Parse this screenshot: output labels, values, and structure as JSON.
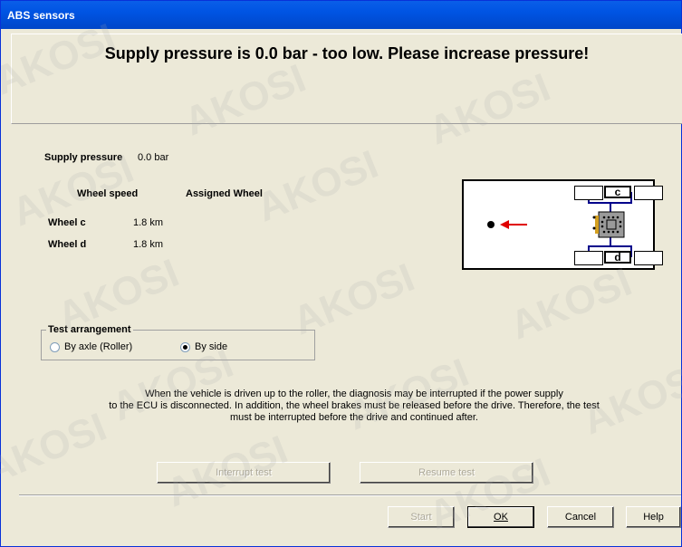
{
  "window": {
    "title": "ABS sensors"
  },
  "header": {
    "message": "Supply pressure is  0.0 bar - too low. Please increase pressure!"
  },
  "supply": {
    "label": "Supply pressure",
    "value": "0.0 bar"
  },
  "table": {
    "col_speed": "Wheel speed",
    "col_assigned": "Assigned Wheel",
    "rows": [
      {
        "wheel": "Wheel c",
        "speed": "1.8 km"
      },
      {
        "wheel": "Wheel d",
        "speed": "1.8 km"
      }
    ]
  },
  "diagram": {
    "top_wheel": "c",
    "bottom_wheel": "d",
    "arrow_color": "#E00000"
  },
  "arrangement": {
    "title": "Test arrangement",
    "options": [
      {
        "label": "By axle (Roller)",
        "selected": false
      },
      {
        "label": "By side",
        "selected": true
      }
    ]
  },
  "info": {
    "lines": [
      "When the vehicle is driven up to the roller, the diagnosis may be interrupted if the power supply",
      "to the ECU is disconnected. In addition, the wheel brakes must be released before the drive. Therefore, the test",
      "must be interrupted before the drive and continued after."
    ]
  },
  "buttons": {
    "interrupt": "Interrupt test",
    "resume": "Resume test",
    "start": "Start",
    "ok": "OK",
    "cancel": "Cancel",
    "help": "Help"
  },
  "watermark": "AKOSI"
}
